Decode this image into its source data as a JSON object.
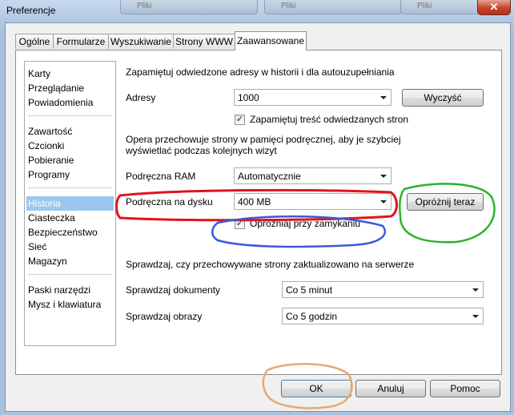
{
  "window": {
    "title": "Preferencje",
    "close_glyph": "✕"
  },
  "background_windows": [
    "Pliki",
    "Pliki",
    "Pliki"
  ],
  "tabs": [
    {
      "label": "Ogólne"
    },
    {
      "label": "Formularze"
    },
    {
      "label": "Wyszukiwanie"
    },
    {
      "label": "Strony WWW"
    },
    {
      "label": "Zaawansowane",
      "active": true
    }
  ],
  "sidebar": {
    "items": [
      "Karty",
      "Przeglądanie",
      "Powiadomienia",
      "Zawartość",
      "Czcionki",
      "Pobieranie",
      "Programy",
      "Historia",
      "Ciasteczka",
      "Bezpieczeństwo",
      "Sieć",
      "Magazyn",
      "Paski narzędzi",
      "Mysz i klawiatura"
    ],
    "selected": "Historia"
  },
  "history": {
    "section_heading": "Zapamiętuj odwiedzone adresy w historii i dla autouzupełniania",
    "addresses_label": "Adresy",
    "addresses_value": "1000",
    "clear_button": "Wyczyść",
    "remember_content_label": "Zapamiętuj treść odwiedzanych stron",
    "remember_content_checked": true,
    "cache_description_line1": "Opera przechowuje strony w pamięci podręcznej, aby je szybciej",
    "cache_description_line2": "wyświetlać podczas kolejnych wizyt",
    "ram_cache_label": "Podręczna RAM",
    "ram_cache_value": "Automatycznie",
    "disk_cache_label": "Podręczna na dysku",
    "disk_cache_value": "400 MB",
    "empty_now_button": "Opróżnij teraz",
    "empty_on_exit_label": "Opróżniaj przy zamykaniu",
    "empty_on_exit_checked": true,
    "check_heading": "Sprawdzaj, czy przechowywane strony zaktualizowano na serwerze",
    "check_documents_label": "Sprawdzaj dokumenty",
    "check_documents_value": "Co 5 minut",
    "check_images_label": "Sprawdzaj obrazy",
    "check_images_value": "Co 5 godzin"
  },
  "footer": {
    "ok": "OK",
    "cancel": "Anuluj",
    "help": "Pomoc"
  },
  "check_glyph": "✓",
  "annotation_colors": {
    "red": "#e0141e",
    "blue": "#3a5ad8",
    "green": "#2bb32b",
    "orange": "#e8a870"
  }
}
